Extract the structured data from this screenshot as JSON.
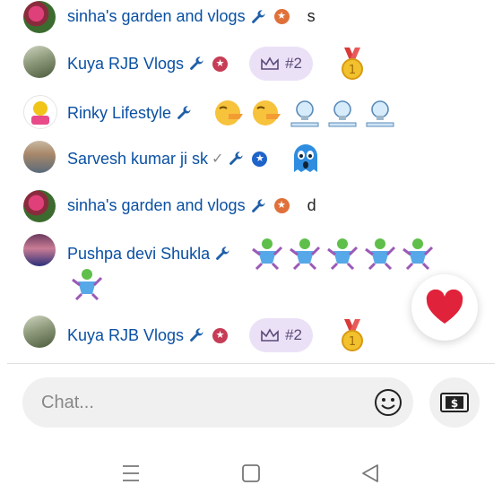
{
  "messages": [
    {
      "author": "sinha's garden and vlogs",
      "text": "s",
      "avatar": "pink-flowers",
      "badge": "orange-star"
    },
    {
      "author": "Kuya RJB Vlogs",
      "rank": "#2",
      "avatar": "family-outdoor",
      "badge": "red-star",
      "sticker": "gold-medal"
    },
    {
      "author": "Rinky Lifestyle",
      "avatar": "lifestyle-logo",
      "emojis": [
        "shush-face",
        "shush-face",
        "idea-bulb",
        "idea-bulb",
        "idea-bulb"
      ]
    },
    {
      "author": "Sarvesh kumar ji sk",
      "avatar": "man-photo",
      "verified": "✓",
      "badge": "blue-star",
      "emojis": [
        "blue-ghost"
      ]
    },
    {
      "author": "sinha's garden and vlogs",
      "text": "d",
      "avatar": "pink-flowers",
      "badge": "orange-star"
    },
    {
      "author": "Pushpa devi Shukla",
      "avatar": "woman-photo",
      "emojis": [
        "dancing-figure",
        "dancing-figure",
        "dancing-figure",
        "dancing-figure",
        "dancing-figure",
        "dancing-figure"
      ]
    },
    {
      "author": "Kuya RJB Vlogs",
      "rank": "#2",
      "avatar": "family-outdoor",
      "badge": "red-star",
      "sticker": "gold-medal"
    }
  ],
  "chat_input": {
    "placeholder": "Chat..."
  },
  "icons": {
    "wrench": "wrench-icon",
    "heart": "heart-icon",
    "smile": "smile-icon",
    "money": "money-icon",
    "nav": [
      "menu-icon",
      "home-icon",
      "back-icon"
    ]
  },
  "colors": {
    "name": "#0a50a3",
    "heart": "#e0223a",
    "rank_pill": "#ebe1f7"
  }
}
